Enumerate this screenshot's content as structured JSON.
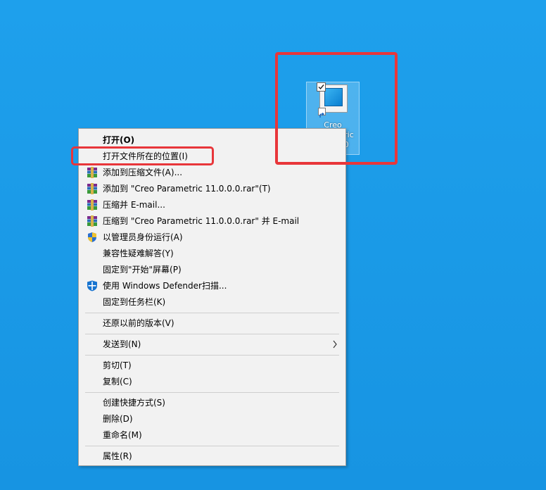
{
  "desktop_icon": {
    "label": "Creo\nParametric\n11.0.0.0"
  },
  "menu": {
    "items": [
      {
        "label": "打开(O)",
        "bold": true
      },
      {
        "label": "打开文件所在的位置(I)"
      },
      {
        "label": "添加到压缩文件(A)...",
        "icon": "winrar-icon"
      },
      {
        "label": "添加到 \"Creo Parametric 11.0.0.0.rar\"(T)",
        "icon": "winrar-icon"
      },
      {
        "label": "压缩并 E-mail...",
        "icon": "winrar-icon"
      },
      {
        "label": "压缩到 \"Creo Parametric 11.0.0.0.rar\" 并 E-mail",
        "icon": "winrar-icon"
      },
      {
        "label": "以管理员身份运行(A)",
        "icon": "uac-shield-icon"
      },
      {
        "label": "兼容性疑难解答(Y)"
      },
      {
        "label": "固定到\"开始\"屏幕(P)"
      },
      {
        "label": "使用 Windows Defender扫描...",
        "icon": "defender-icon"
      },
      {
        "label": "固定到任务栏(K)"
      },
      {
        "label": "还原以前的版本(V)"
      },
      {
        "label": "发送到(N)",
        "submenu": true
      },
      {
        "label": "剪切(T)"
      },
      {
        "label": "复制(C)"
      },
      {
        "label": "创建快捷方式(S)"
      },
      {
        "label": "删除(D)"
      },
      {
        "label": "重命名(M)"
      },
      {
        "label": "属性(R)"
      }
    ]
  },
  "colors": {
    "desktop": "#1a9ae8",
    "highlight": "#e8363a",
    "menu_bg": "#f2f2f2"
  }
}
